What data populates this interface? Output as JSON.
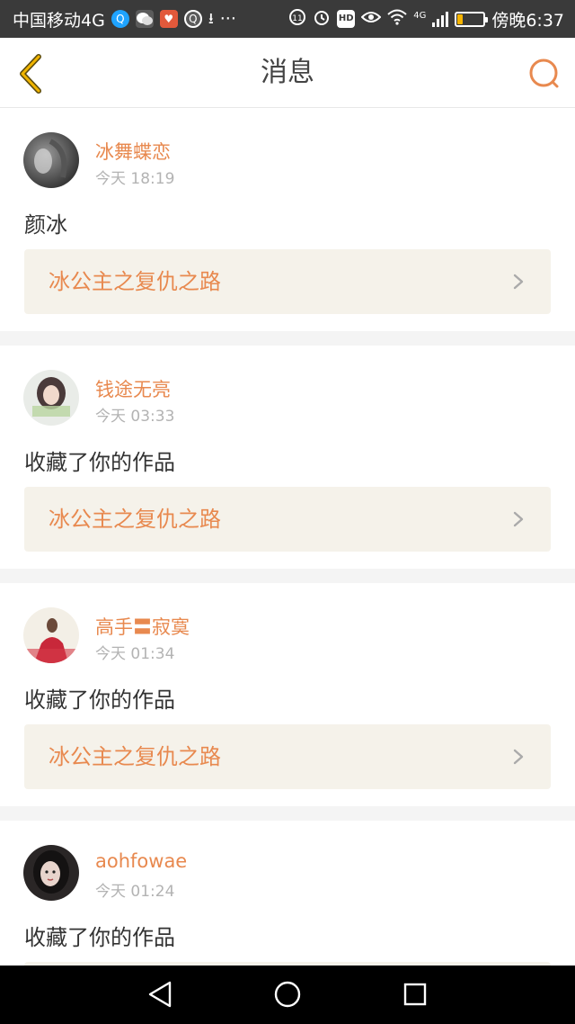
{
  "status_bar": {
    "carrier": "中国移动4G",
    "more": "···",
    "network": "4G",
    "time": "傍晚6:37",
    "battery_level": 0.18,
    "icons": [
      "qq-icon",
      "wechat-icon",
      "app-icon",
      "qq-icon",
      "download-icon",
      "data-saver-icon",
      "alarm-icon",
      "hd-icon",
      "eye-icon",
      "wifi-icon",
      "signal-icon",
      "battery-icon"
    ]
  },
  "header": {
    "title": "消息",
    "back_icon": "chevron-left-icon",
    "search_icon": "search-icon",
    "accent_color": "#e8894f",
    "back_color": "#f0b400"
  },
  "messages": [
    {
      "username": "冰舞蝶恋",
      "time": "今天 18:19",
      "text": "颜冰",
      "work_title": "冰公主之复仇之路"
    },
    {
      "username": "钱途无亮",
      "time": "今天 03:33",
      "text": "收藏了你的作品",
      "work_title": "冰公主之复仇之路"
    },
    {
      "username": "高手〓寂寞",
      "time": "今天 01:34",
      "text": "收藏了你的作品",
      "work_title": "冰公主之复仇之路"
    },
    {
      "username": "aohfowae",
      "time": "今天 01:24",
      "text": "收藏了你的作品",
      "work_title": ""
    }
  ],
  "nav_bar": {
    "icons": [
      "back-triangle-icon",
      "home-circle-icon",
      "recents-square-icon"
    ]
  }
}
